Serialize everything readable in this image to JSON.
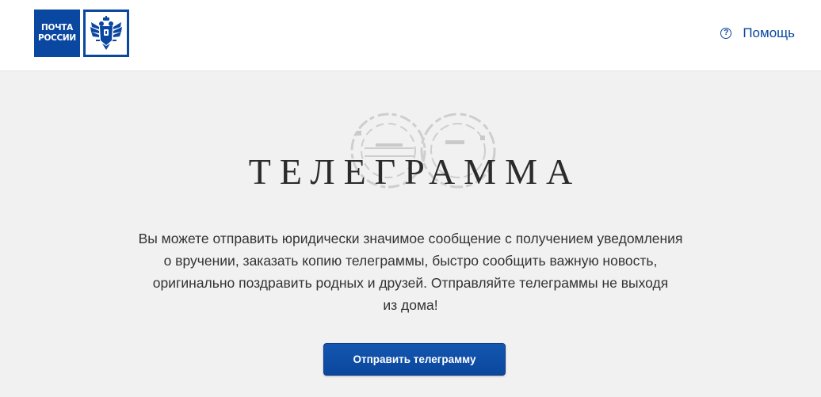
{
  "header": {
    "logo": {
      "line1": "ПОЧТА",
      "line2": "РОССИИ"
    },
    "help": {
      "icon": "question-circle-icon",
      "label": "Помощь"
    }
  },
  "main": {
    "title": "ТЕЛЕГРАММА",
    "description_lines": [
      "Вы можете отправить юридически значимое сообщение с получением уведомления",
      "о вручении, заказать копию телеграммы, быстро сообщить важную новость,",
      "оригинально поздравить родных и друзей. Отправляйте телеграммы не выходя",
      "из дома!"
    ],
    "cta_label": "Отправить телеграмму"
  },
  "colors": {
    "brand_blue": "#0a47a1",
    "page_background": "#f1f1f1",
    "header_background": "#ffffff"
  }
}
